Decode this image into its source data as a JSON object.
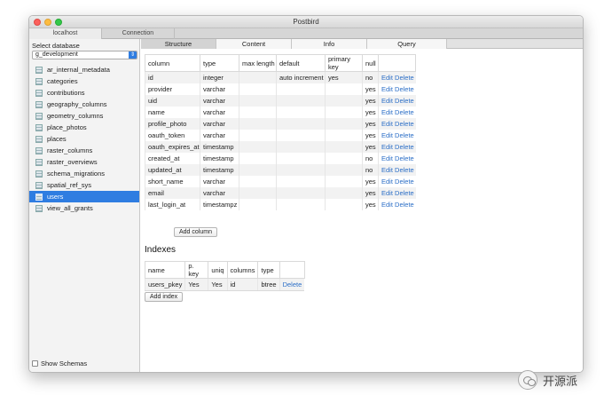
{
  "window": {
    "title": "Postbird"
  },
  "connection_tabs": [
    "localhost",
    "Connection"
  ],
  "sidebar": {
    "select_database_label": "Select database",
    "selected_database": "g_development",
    "tables": [
      "ar_internal_metadata",
      "categories",
      "contributions",
      "geography_columns",
      "geometry_columns",
      "place_photos",
      "places",
      "raster_columns",
      "raster_overviews",
      "schema_migrations",
      "spatial_ref_sys",
      "users",
      "view_all_grants"
    ],
    "selected_table": "users",
    "show_schemas_label": "Show Schemas",
    "toolbar_icons": [
      "add-icon",
      "refresh-icon",
      "user-icon",
      "plug-icon",
      "filter-icon"
    ]
  },
  "main": {
    "tabs": [
      "Structure",
      "Content",
      "Info",
      "Query"
    ],
    "active_tab": "Structure",
    "structure": {
      "headers": [
        "column",
        "type",
        "max length",
        "default",
        "primary key",
        "null",
        ""
      ],
      "rows": [
        [
          "id",
          "integer",
          "",
          "auto increment",
          "yes",
          "no"
        ],
        [
          "provider",
          "varchar",
          "",
          "",
          "",
          "yes"
        ],
        [
          "uid",
          "varchar",
          "",
          "",
          "",
          "yes"
        ],
        [
          "name",
          "varchar",
          "",
          "",
          "",
          "yes"
        ],
        [
          "profile_photo",
          "varchar",
          "",
          "",
          "",
          "yes"
        ],
        [
          "oauth_token",
          "varchar",
          "",
          "",
          "",
          "yes"
        ],
        [
          "oauth_expires_at",
          "timestamp",
          "",
          "",
          "",
          "yes"
        ],
        [
          "created_at",
          "timestamp",
          "",
          "",
          "",
          "no"
        ],
        [
          "updated_at",
          "timestamp",
          "",
          "",
          "",
          "no"
        ],
        [
          "short_name",
          "varchar",
          "",
          "",
          "",
          "yes"
        ],
        [
          "email",
          "varchar",
          "",
          "",
          "",
          "yes"
        ],
        [
          "last_login_at",
          "timestampz",
          "",
          "",
          "",
          "yes"
        ]
      ],
      "edit_label": "Edit",
      "delete_label": "Delete",
      "add_column_label": "Add column"
    },
    "indexes": {
      "title": "Indexes",
      "headers": [
        "name",
        "p. key",
        "uniq",
        "columns",
        "type",
        ""
      ],
      "rows": [
        [
          "users_pkey",
          "Yes",
          "Yes",
          "id",
          "btree"
        ]
      ],
      "delete_label": "Delete",
      "add_index_label": "Add index"
    }
  },
  "watermark": {
    "text": "开源派"
  },
  "colors": {
    "accent": "#2f7de1",
    "link": "#2c6fc7",
    "add_green": "#3fae4a"
  }
}
